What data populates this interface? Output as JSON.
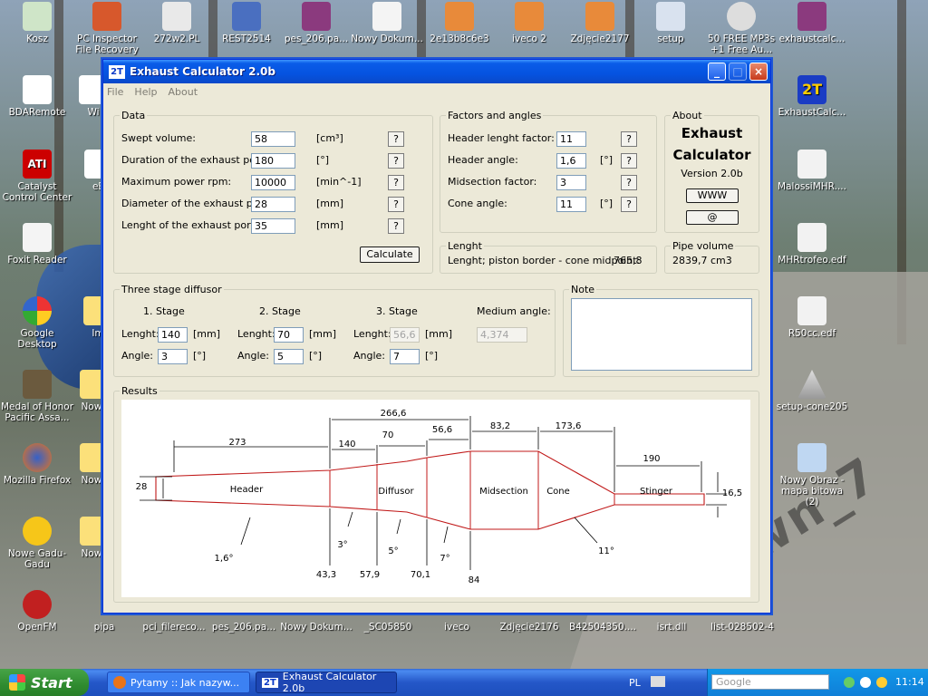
{
  "desktop": {
    "icons": [
      {
        "label": "Kosz"
      },
      {
        "label": "PC Inspector File Recovery"
      },
      {
        "label": "272w2.PL"
      },
      {
        "label": "REST2514"
      },
      {
        "label": "pes_206.pa..."
      },
      {
        "label": "Nowy Dokum..."
      },
      {
        "label": "2e13b8c6e3"
      },
      {
        "label": "iveco 2"
      },
      {
        "label": "Zdjęcie2177"
      },
      {
        "label": "setup"
      },
      {
        "label": "50 FREE MP3s +1 Free Au..."
      },
      {
        "label": "exhaustcalc..."
      },
      {
        "label": "BDARemote"
      },
      {
        "label": "Wi"
      },
      {
        "label": "ExhaustCalc..."
      },
      {
        "label": "Catalyst Control Center"
      },
      {
        "label": "eE"
      },
      {
        "label": "MalossiMHR...."
      },
      {
        "label": "Foxit Reader"
      },
      {
        "label": "MHRtrofeo.edf"
      },
      {
        "label": "Google Desktop"
      },
      {
        "label": "Im"
      },
      {
        "label": "R50cc.edf"
      },
      {
        "label": "Medal of Honor Pacific Assa..."
      },
      {
        "label": "Nowy"
      },
      {
        "label": "setup-cone205"
      },
      {
        "label": "Mozilla Firefox"
      },
      {
        "label": "Nowy"
      },
      {
        "label": "Nowy Obraz - mapa bitowa (2)"
      },
      {
        "label": "Nowe Gadu-Gadu"
      },
      {
        "label": "Nowy"
      },
      {
        "label": "OpenFM"
      },
      {
        "label": "pipa"
      },
      {
        "label": "pci_filereco..."
      },
      {
        "label": "pes_206.pa..."
      },
      {
        "label": "Nowy Dokum..."
      },
      {
        "label": "_SC05850"
      },
      {
        "label": "iveco"
      },
      {
        "label": "Zdjęcie2176"
      },
      {
        "label": "B42504350...."
      },
      {
        "label": "isrt.dll"
      },
      {
        "label": "list-028502-4"
      }
    ],
    "watermark": "spawn_7"
  },
  "window": {
    "title": "Exhaust Calculator 2.0b",
    "logo": "2T",
    "menu": [
      "File",
      "Help",
      "About"
    ],
    "controls": {
      "minimize": "_",
      "maximize": "□",
      "close": "×"
    }
  },
  "data_group": {
    "legend": "Data",
    "rows": [
      {
        "label": "Swept volume:",
        "value": "58",
        "unit": "[cm³]",
        "help": "?"
      },
      {
        "label": "Duration of the exhaust port:",
        "value": "180",
        "unit": "[°]",
        "help": "?"
      },
      {
        "label": "Maximum power rpm:",
        "value": "10000",
        "unit": "[min^-1]",
        "help": "?"
      },
      {
        "label": "Diameter of the exhaust port:",
        "value": "28",
        "unit": "[mm]",
        "help": "?"
      },
      {
        "label": "Lenght of the exhaust port:",
        "value": "35",
        "unit": "[mm]",
        "help": "?"
      }
    ],
    "calculate": "Calculate"
  },
  "factors_group": {
    "legend": "Factors and angles",
    "rows": [
      {
        "label": "Header lenght factor:",
        "value": "11",
        "unit": "",
        "help": "?"
      },
      {
        "label": "Header angle:",
        "value": "1,6",
        "unit": "[°]",
        "help": "?"
      },
      {
        "label": "Midsection factor:",
        "value": "3",
        "unit": "",
        "help": "?"
      },
      {
        "label": "Cone angle:",
        "value": "11",
        "unit": "[°]",
        "help": "?"
      }
    ]
  },
  "about_group": {
    "legend": "About",
    "title_line1": "Exhaust",
    "title_line2": "Calculator",
    "version": "Version 2.0b",
    "www": "WWW",
    "email": "@"
  },
  "length_group": {
    "legend": "Lenght",
    "text": "Lenght; piston border - cone midpoint:",
    "value": "765,8"
  },
  "pipe_volume_group": {
    "legend": "Pipe volume",
    "value": "2839,7 cm3"
  },
  "diffusor_group": {
    "legend": "Three stage diffusor",
    "stages": [
      {
        "title": "1. Stage",
        "len_label": "Lenght:",
        "len": "140",
        "len_unit": "[mm]",
        "ang_label": "Angle:",
        "ang": "3",
        "ang_unit": "[°]"
      },
      {
        "title": "2. Stage",
        "len_label": "Lenght:",
        "len": "70",
        "len_unit": "[mm]",
        "ang_label": "Angle:",
        "ang": "5",
        "ang_unit": "[°]"
      },
      {
        "title": "3. Stage",
        "len_label": "Lenght:",
        "len": "56,6",
        "len_unit": "[mm]",
        "ang_label": "Angle:",
        "ang": "7",
        "ang_unit": "[°]"
      }
    ],
    "medium_label": "Medium angle:",
    "medium_value": "4,374"
  },
  "note_group": {
    "legend": "Note",
    "text": ""
  },
  "results": {
    "legend": "Results",
    "sections": {
      "header": "Header",
      "diffusor": "Diffusor",
      "midsection": "Midsection",
      "cone": "Cone",
      "stinger": "Stinger"
    },
    "top_dims": {
      "header_len": "273",
      "diffusor_total": "266,6",
      "stage1": "140",
      "stage2": "70",
      "stage3": "56,6",
      "midsection": "83,2",
      "cone": "173,6",
      "stinger": "190"
    },
    "diameters": {
      "port": "28",
      "d1": "43,3",
      "d2": "57,9",
      "d3": "70,1",
      "d4": "84",
      "stinger": "16,5"
    },
    "angles": {
      "header": "1,6°",
      "stage1": "3°",
      "stage2": "5°",
      "stage3": "7°",
      "cone": "11°"
    }
  },
  "taskbar": {
    "start": "Start",
    "tasks": [
      "Pytamy :: Jak nazyw...",
      "Exhaust Calculator 2.0b"
    ],
    "lang": "PL",
    "time": "11:14",
    "search_placeholder": "Google"
  }
}
